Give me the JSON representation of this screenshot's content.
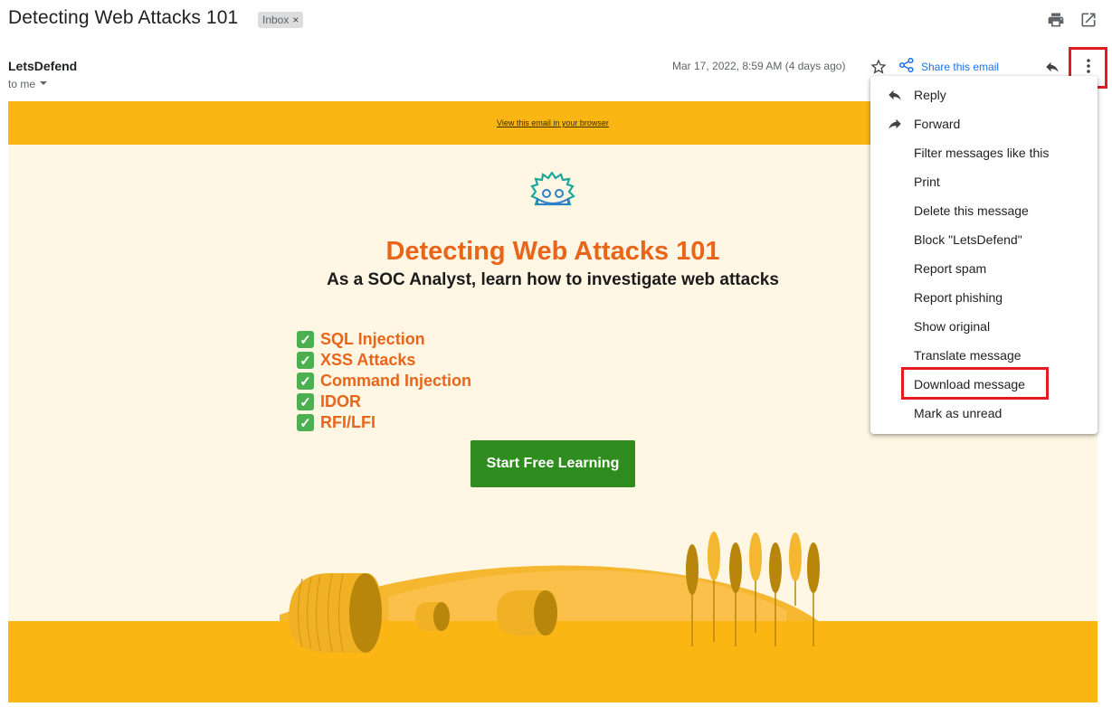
{
  "header": {
    "subject": "Detecting Web Attacks 101",
    "label_chip": "Inbox",
    "label_remove": "×",
    "print_icon": "print-icon",
    "open_new_window_icon": "open-in-new-window-icon"
  },
  "message": {
    "sender": "LetsDefend",
    "to": "to me",
    "date": "Mar 17, 2022, 8:59 AM (4 days ago)",
    "share_label": "Share this email"
  },
  "email": {
    "view_in_browser": "View this email in your browser",
    "title": "Detecting Web Attacks 101",
    "subtitle": "As a SOC Analyst, learn how to investigate web attacks",
    "topics": [
      "SQL Injection",
      "XSS Attacks",
      "Command Injection",
      "IDOR",
      "RFI/LFI"
    ],
    "cta": "Start Free Learning",
    "colors": {
      "banner": "#fbb614",
      "body": "#fff7e4",
      "accent": "#e8651a",
      "cta": "#2f8c1f"
    }
  },
  "menu": {
    "items": [
      {
        "label": "Reply",
        "icon": "reply-icon"
      },
      {
        "label": "Forward",
        "icon": "forward-icon"
      },
      {
        "label": "Filter messages like this"
      },
      {
        "label": "Print"
      },
      {
        "label": "Delete this message"
      },
      {
        "label": "Block \"LetsDefend\""
      },
      {
        "label": "Report spam"
      },
      {
        "label": "Report phishing"
      },
      {
        "label": "Show original"
      },
      {
        "label": "Translate message"
      },
      {
        "label": "Download message"
      },
      {
        "label": "Mark as unread"
      }
    ],
    "highlight_color": "#e31b23"
  }
}
